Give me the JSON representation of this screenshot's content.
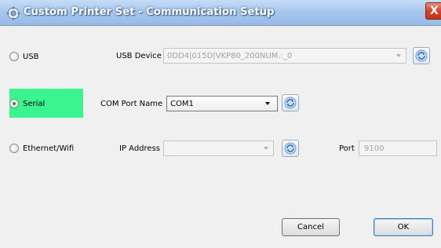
{
  "window": {
    "title": "Custom Printer Set - Communication Setup",
    "close_label": "X"
  },
  "usb": {
    "radio_label": "USB",
    "selected": false,
    "device_label": "USB Device",
    "device_value": "0DD4|015D|VKP80_200NUM.:_0"
  },
  "serial": {
    "radio_label": "Serial",
    "selected": true,
    "highlight_color": "#3af58f",
    "port_label": "COM Port Name",
    "port_value": "COM1"
  },
  "ethernet": {
    "radio_label": "Ethernet/Wifi",
    "selected": false,
    "ip_label": "IP Address",
    "ip_value": "",
    "port_label": "Port",
    "port_value": "9100"
  },
  "buttons": {
    "cancel_label": "Cancel",
    "ok_label": "OK"
  },
  "icons": {
    "app": "printer-gear-icon",
    "refresh": "refresh-icon",
    "dropdown": "chevron-down-icon"
  }
}
